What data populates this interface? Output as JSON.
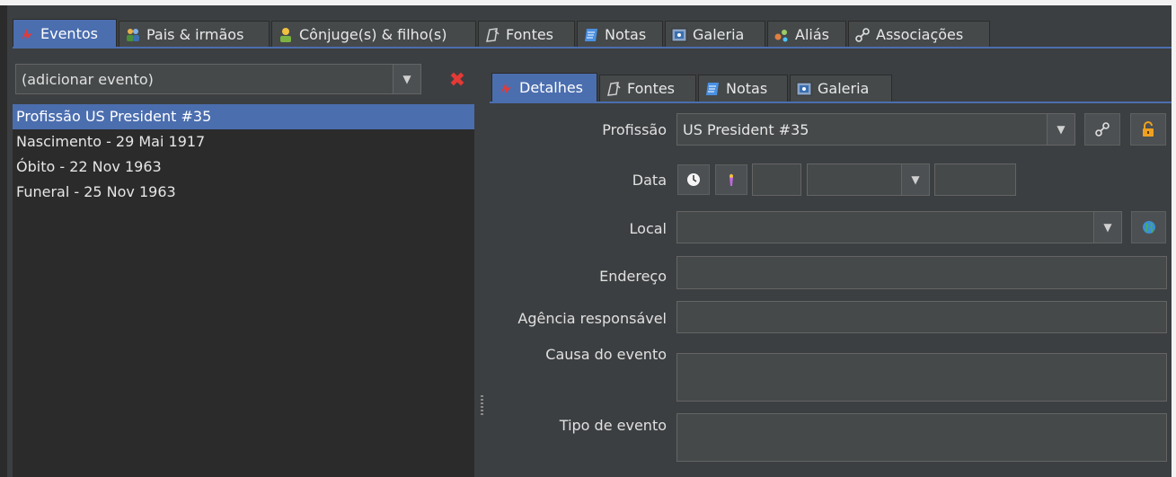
{
  "top_tabs": [
    {
      "label": "Eventos",
      "icon": "event-icon"
    },
    {
      "label": "Pais & irmãos",
      "icon": "family-icon"
    },
    {
      "label": "Cônjuge(s) & filho(s)",
      "icon": "spouse-icon"
    },
    {
      "label": "Fontes",
      "icon": "source-icon"
    },
    {
      "label": "Notas",
      "icon": "notes-icon"
    },
    {
      "label": "Galeria",
      "icon": "gallery-icon"
    },
    {
      "label": "Aliás",
      "icon": "alias-icon"
    },
    {
      "label": "Associações",
      "icon": "association-icon"
    }
  ],
  "event_selector": {
    "value": "(adicionar evento)"
  },
  "events": [
    "Profissão US President #35",
    "Nascimento - 29 Mai 1917",
    "Óbito - 22 Nov 1963",
    "Funeral - 25 Nov 1963"
  ],
  "sub_tabs": [
    {
      "label": "Detalhes",
      "icon": "event-icon"
    },
    {
      "label": "Fontes",
      "icon": "source-icon"
    },
    {
      "label": "Notas",
      "icon": "notes-icon"
    },
    {
      "label": "Galeria",
      "icon": "gallery-icon"
    }
  ],
  "form": {
    "profissao_label": "Profissão",
    "profissao_value": "US President #35",
    "data_label": "Data",
    "local_label": "Local",
    "endereco_label": "Endereço",
    "agencia_label": "Agência responsável",
    "causa_label": "Causa do evento",
    "tipo_label": "Tipo de evento"
  },
  "colors": {
    "accent": "#4b6eaf",
    "background": "#3c3f41",
    "list_background": "#2b2b2b",
    "delete": "#e53935",
    "lock": "#f0a020"
  }
}
